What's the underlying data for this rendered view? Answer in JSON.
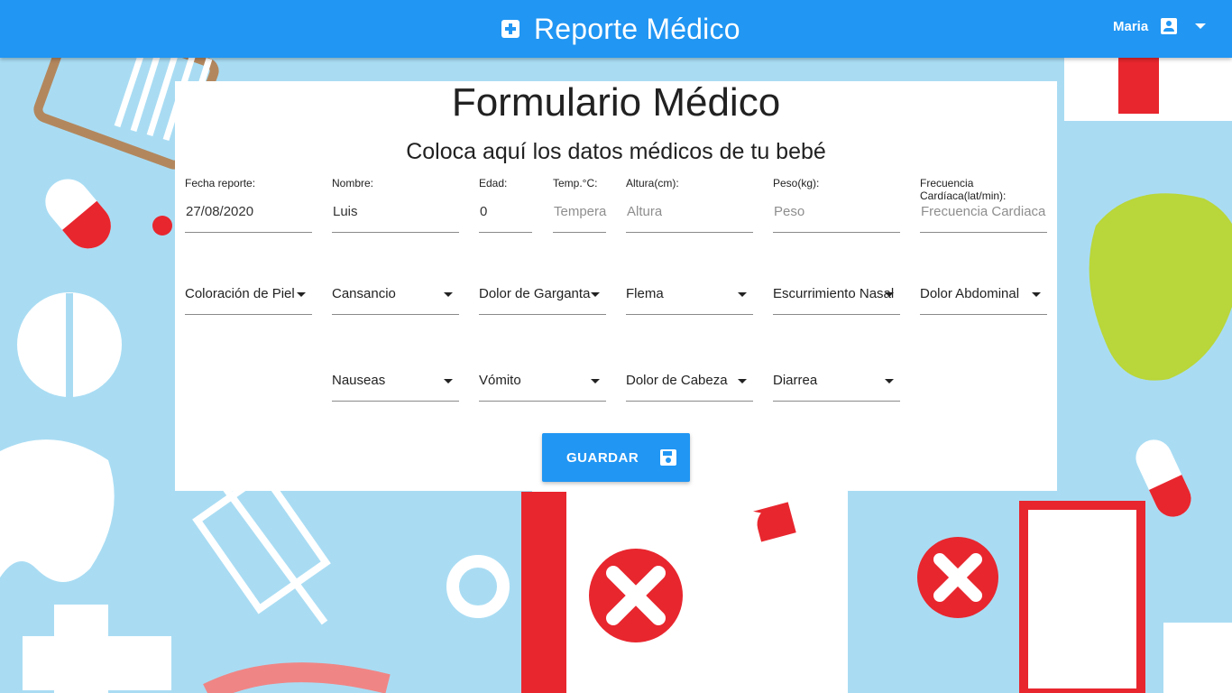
{
  "app": {
    "title": "Reporte Médico",
    "user_name": "Maria"
  },
  "form": {
    "title": "Formulario Médico",
    "subtitle": "Coloca aquí los datos médicos de tu bebé",
    "inputs": [
      {
        "label": "Fecha reporte:",
        "value": "27/08/2020",
        "placeholder": ""
      },
      {
        "label": "Nombre:",
        "value": "Luis",
        "placeholder": ""
      },
      {
        "label": "Edad:",
        "value": "0",
        "placeholder": ""
      },
      {
        "label": "Temp.°C:",
        "value": "",
        "placeholder": "Tempera"
      },
      {
        "label": "Altura(cm):",
        "value": "",
        "placeholder": "Altura"
      },
      {
        "label": "Peso(kg):",
        "value": "",
        "placeholder": "Peso"
      },
      {
        "label": "Frecuencia Cardíaca(lat/min):",
        "value": "",
        "placeholder": "Frecuencia Cardiaca"
      }
    ],
    "selects_row1": [
      "Coloración de Piel",
      "Cansancio",
      "Dolor de Garganta",
      "Flema",
      "Escurrimiento Nasal",
      "Dolor Abdominal"
    ],
    "selects_row2": [
      "Nauseas",
      "Vómito",
      "Dolor de Cabeza",
      "Diarrea"
    ],
    "save_label": "GUARDAR"
  },
  "colors": {
    "primary": "#2196f3",
    "background": "#a9dcf3",
    "accent_red": "#e8262e"
  },
  "icons": {
    "brand": "medical-plus-icon",
    "user": "account-box-icon",
    "menu": "caret-down-icon",
    "save": "floppy-disk-icon"
  }
}
